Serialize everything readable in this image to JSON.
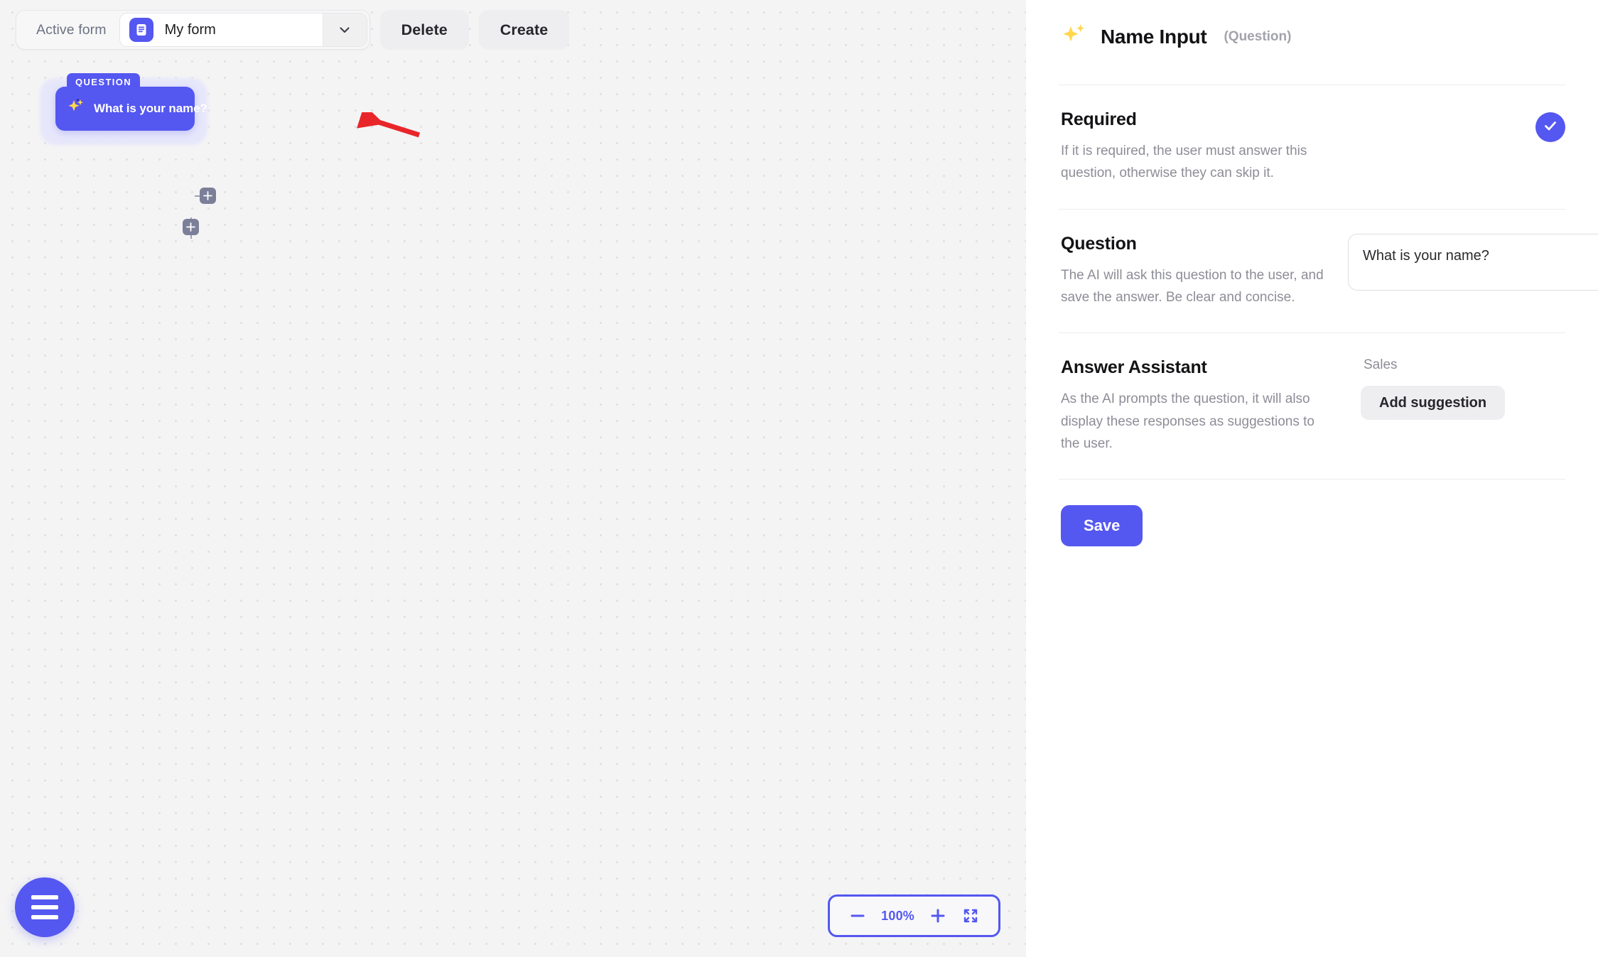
{
  "toolbar": {
    "active_form_label": "Active form",
    "form_name": "My form",
    "form_icon": "document-icon",
    "dropdown_icon": "chevron-down-icon",
    "delete_label": "Delete",
    "create_label": "Create"
  },
  "canvas": {
    "node": {
      "badge": "QUESTION",
      "icon": "sparkles-icon",
      "title": "What is your name?",
      "handle_right_icon": "plus-icon",
      "handle_bottom_icon": "plus-icon"
    },
    "annotation": {
      "type": "red-arrow",
      "color": "#e8262a",
      "points_to": "node-add-handle-right"
    },
    "menu_button_icon": "hamburger-menu-icon",
    "zoom": {
      "zoom_out_icon": "minus-icon",
      "level": "100%",
      "zoom_in_icon": "plus-icon",
      "fit_view_icon": "fullscreen-icon"
    }
  },
  "panel": {
    "icon": "sparkles-icon",
    "title": "Name Input",
    "subtitle": "(Question)",
    "sections": {
      "required": {
        "heading": "Required",
        "description": "If it is required, the user must answer this question, otherwise they can skip it.",
        "toggle_icon": "check-icon",
        "toggle_state": "on"
      },
      "question": {
        "heading": "Question",
        "description": "The AI will ask this question to the user, and save the answer. Be clear and concise.",
        "value": "What is your name?",
        "placeholder": "What is your name?"
      },
      "answer_assistant": {
        "heading": "Answer Assistant",
        "description": "As the AI prompts the question, it will also display these responses as suggestions to the user.",
        "group_label": "Sales",
        "add_suggestion_label": "Add suggestion"
      }
    },
    "save_label": "Save"
  },
  "colors": {
    "accent": "#5457f0",
    "canvas_bg": "#f4f4f5",
    "annotation_red": "#e8262a",
    "sparkle_yellow": "#ffd84d"
  }
}
